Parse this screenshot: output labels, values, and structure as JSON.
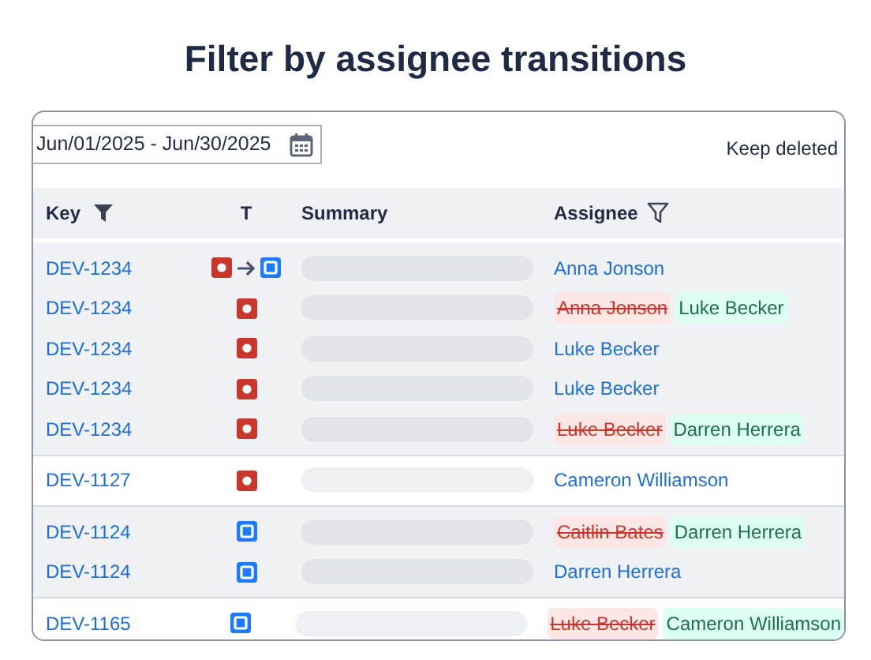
{
  "title": "Filter by assignee transitions",
  "date_range": {
    "value": "Jun/01/2025 - Jun/30/2025"
  },
  "keep_deleted": {
    "label": "Keep deleted"
  },
  "table": {
    "columns": [
      "Key",
      "T",
      "Summary",
      "Assignee"
    ],
    "groups": [
      {
        "rows": [
          {
            "key": "DEV-1234",
            "types": [
              {
                "kind": "bug"
              },
              {
                "kind": "task"
              }
            ],
            "assignees": [
              {
                "name": "Anna Jonson",
                "kind": "current"
              }
            ]
          },
          {
            "key": "DEV-1234",
            "types": [
              {
                "kind": "bug"
              }
            ],
            "assignees": [
              {
                "name": "Anna Jonson",
                "kind": "removed"
              },
              {
                "name": "Luke Becker",
                "kind": "added"
              }
            ]
          },
          {
            "key": "DEV-1234",
            "types": [
              {
                "kind": "bug"
              }
            ],
            "assignees": [
              {
                "name": "Luke Becker",
                "kind": "current"
              }
            ]
          },
          {
            "key": "DEV-1234",
            "types": [
              {
                "kind": "bug"
              }
            ],
            "assignees": [
              {
                "name": "Luke Becker",
                "kind": "current"
              }
            ]
          },
          {
            "key": "DEV-1234",
            "types": [
              {
                "kind": "bug"
              }
            ],
            "assignees": [
              {
                "name": "Luke Becker",
                "kind": "removed"
              },
              {
                "name": "Darren Herrera",
                "kind": "added"
              }
            ]
          }
        ]
      },
      {
        "rows": [
          {
            "key": "DEV-1127",
            "types": [
              {
                "kind": "bug"
              }
            ],
            "assignees": [
              {
                "name": "Cameron Williamson",
                "kind": "current"
              }
            ]
          }
        ]
      },
      {
        "rows": [
          {
            "key": "DEV-1124",
            "types": [
              {
                "kind": "task"
              }
            ],
            "assignees": [
              {
                "name": "Caitlin Bates",
                "kind": "removed"
              },
              {
                "name": "Darren Herrera",
                "kind": "added"
              }
            ]
          },
          {
            "key": "DEV-1124",
            "types": [
              {
                "kind": "task"
              }
            ],
            "assignees": [
              {
                "name": "Darren Herrera",
                "kind": "current"
              }
            ]
          }
        ]
      },
      {
        "rows": [
          {
            "key": "DEV-1165",
            "types": [
              {
                "kind": "task"
              }
            ],
            "assignees": [
              {
                "name": "Luke Becker",
                "kind": "removed"
              },
              {
                "name": "Cameron Williamson",
                "kind": "added"
              }
            ]
          }
        ]
      }
    ]
  }
}
